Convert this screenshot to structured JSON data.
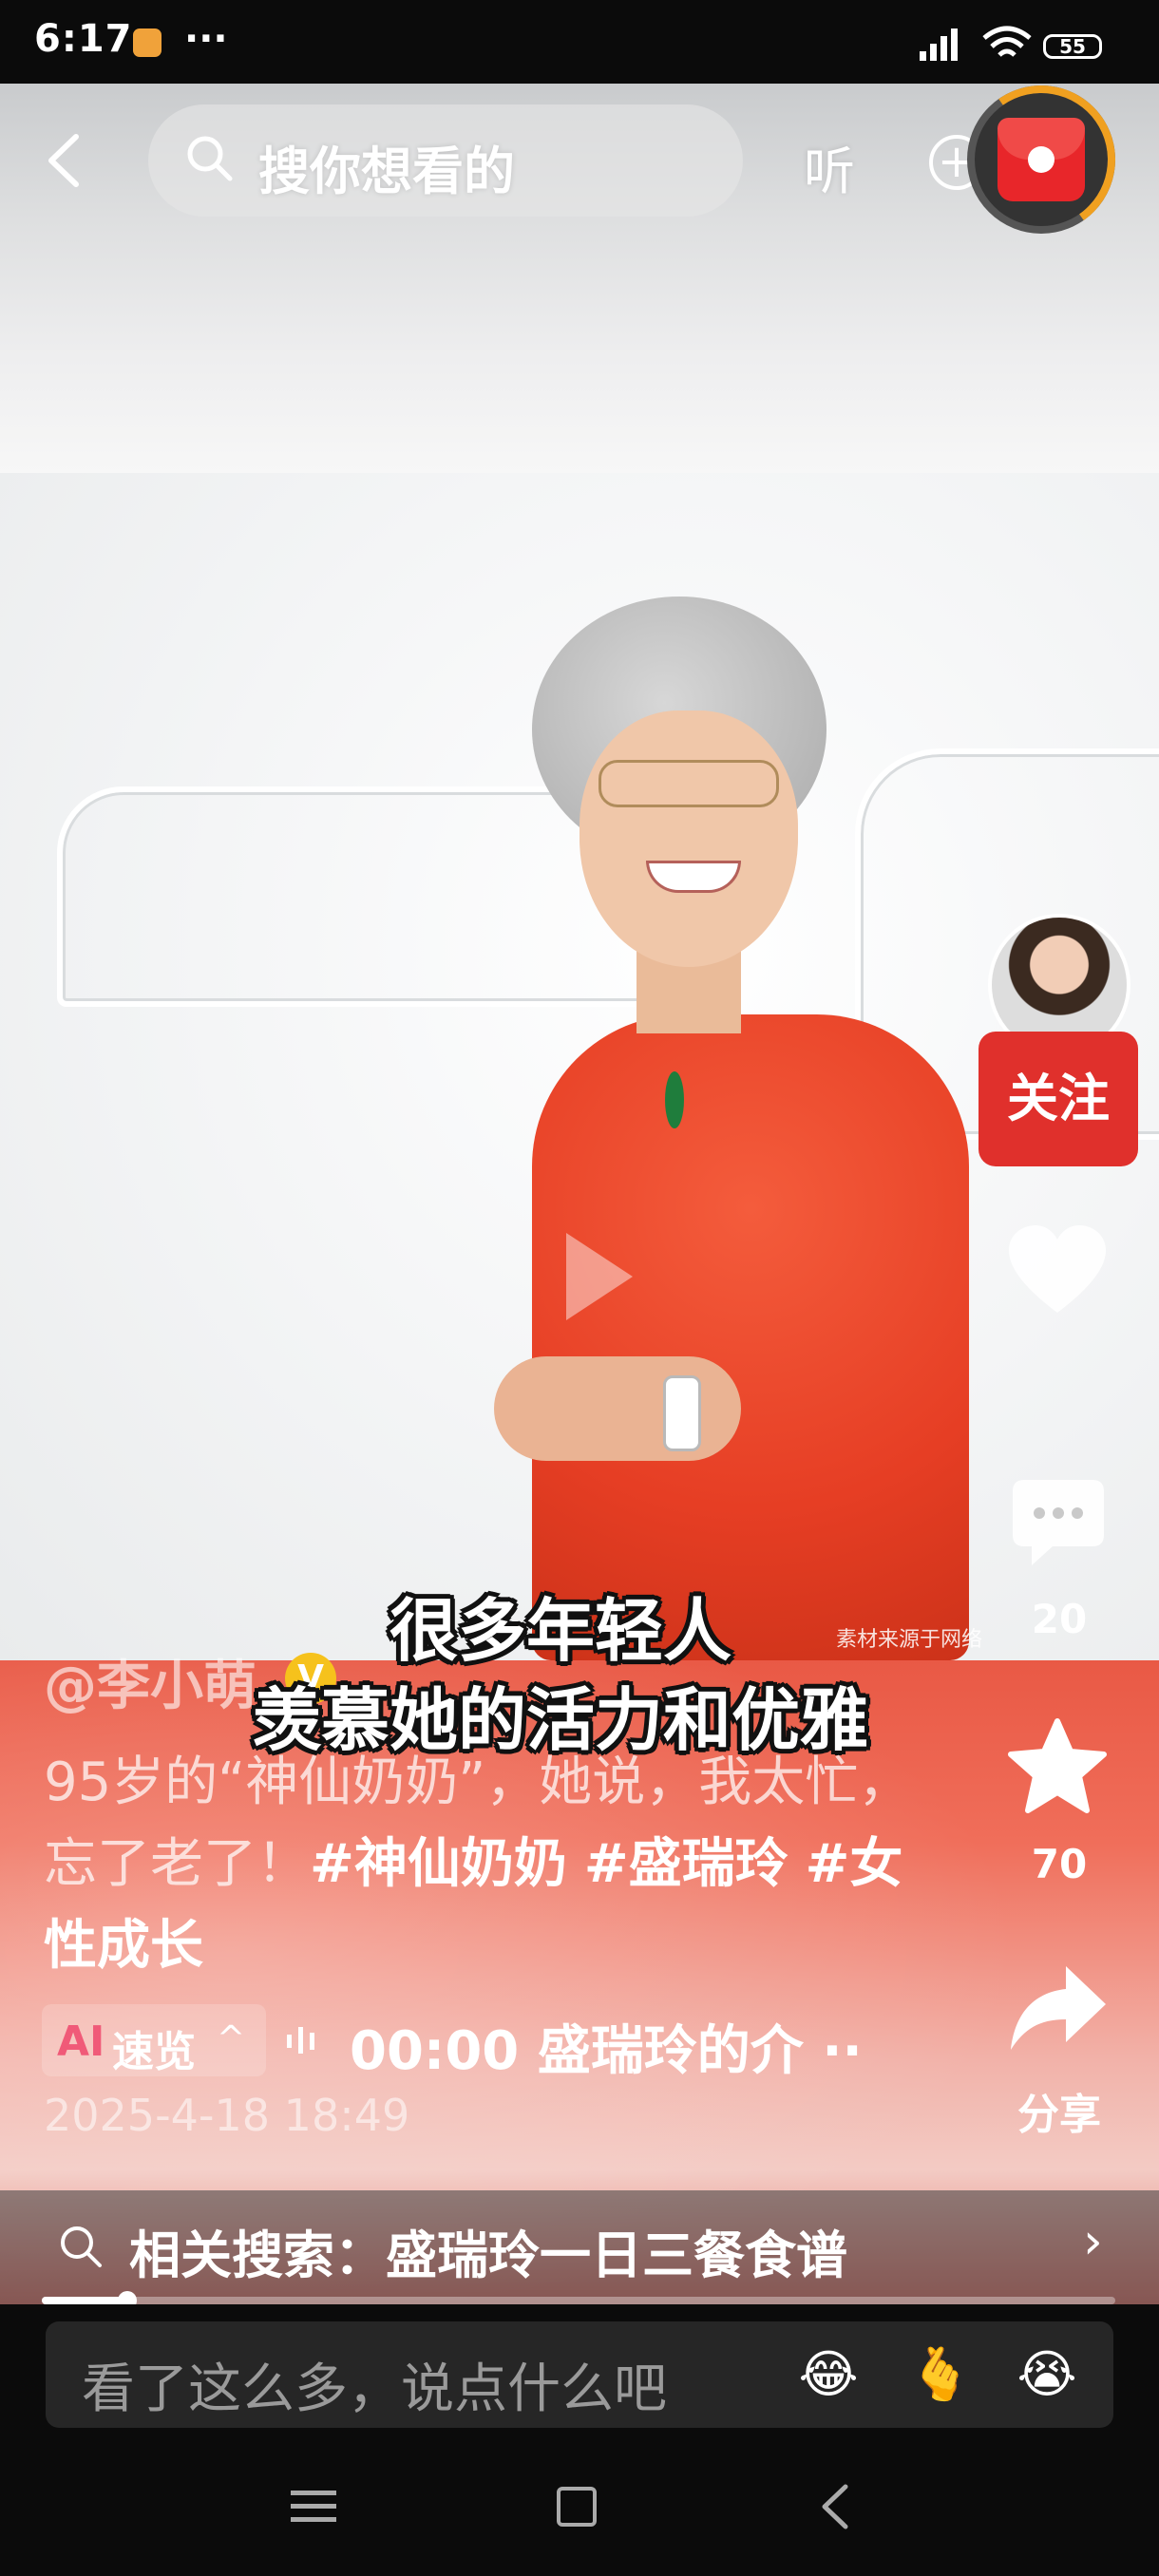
{
  "status_bar": {
    "time": "6:17",
    "more": "···",
    "battery": "55"
  },
  "top_bar": {
    "search_placeholder": "搜你想看的",
    "listen_label": "听",
    "add": "+"
  },
  "video": {
    "watermark": "素材来源于网络",
    "subtitle_line1": "很多年轻人",
    "subtitle_line2": "羡慕她的活力和优雅"
  },
  "author": {
    "name": "@李小萌",
    "verified": "V"
  },
  "description": {
    "text": "95岁的“神仙奶奶”，她说，我太忙，忘了老了！",
    "tags": [
      "#神仙奶奶",
      "#盛瑞玲",
      "#女性成长"
    ]
  },
  "ai_summary": {
    "logo": "AI",
    "label": "速览",
    "chevron": "^",
    "audio_text": "00:00 盛瑞玲的介 ··"
  },
  "timestamp": "2025-4-18 18:49",
  "right_rail": {
    "follow_label": "关注",
    "like_count": "",
    "comment_count": "20",
    "favorite_count": "70",
    "share_label": "分享"
  },
  "related_search": {
    "text": "相关搜索：盛瑞玲一日三餐食谱",
    "chevron": "›"
  },
  "playback": {
    "progress": 0.08
  },
  "comment_bar": {
    "placeholder": "看了这么多，说点什么吧",
    "emojis": [
      "😂",
      "🫰",
      "😭"
    ]
  },
  "colors": {
    "accent_red": "#e0302c",
    "verified_gold": "#f6c21c",
    "background": "#0b0b0b"
  },
  "icons": [
    "back-icon",
    "search-icon",
    "add-icon",
    "red-packet-icon",
    "heart-icon",
    "comment-icon",
    "star-icon",
    "share-icon",
    "menu-icon",
    "home-icon",
    "nav-back-icon"
  ]
}
